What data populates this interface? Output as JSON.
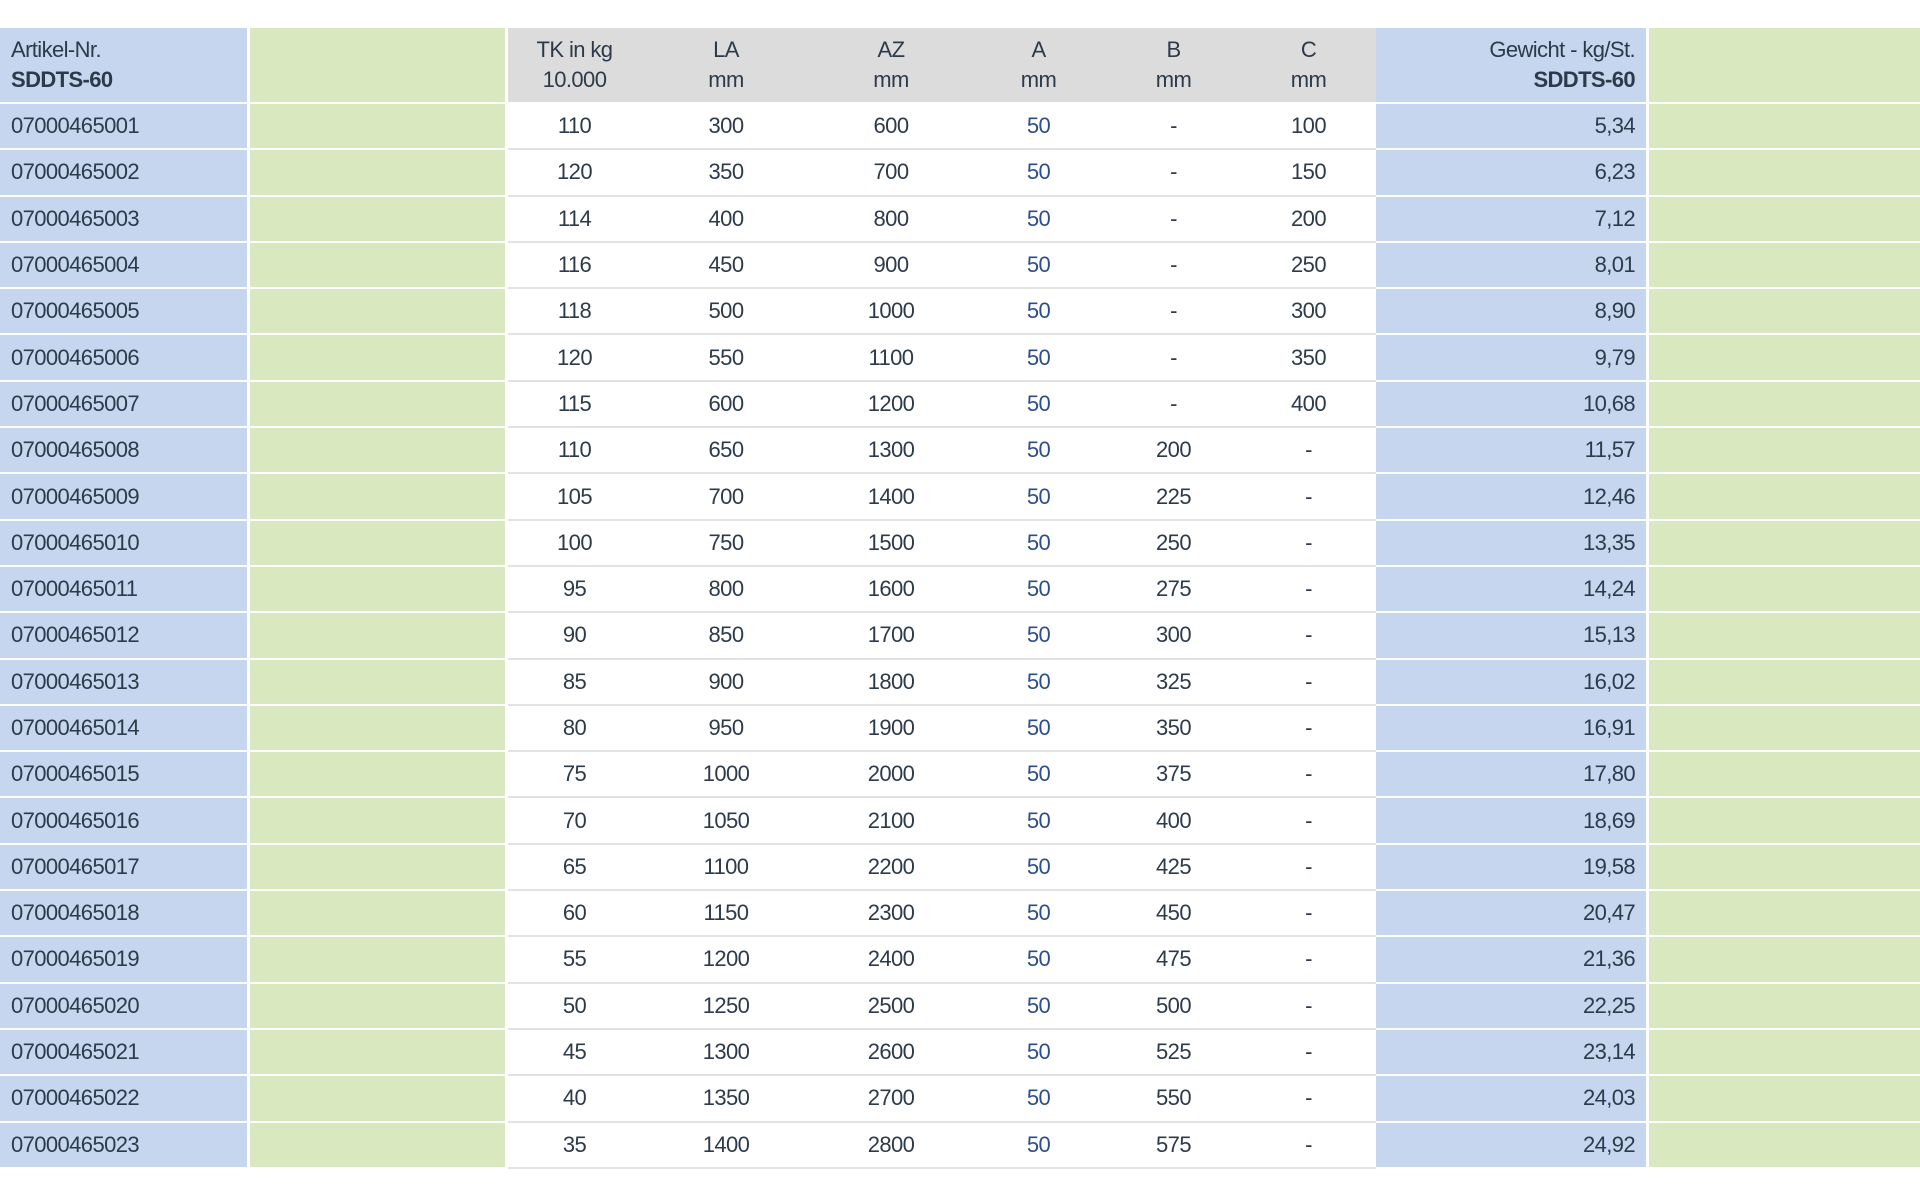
{
  "header": {
    "artikel_label": "Artikel-Nr.",
    "artikel_sub": "SDDTS-60",
    "tk_label": "TK in kg",
    "tk_sub": "10.000",
    "la_label": "LA",
    "la_sub": "mm",
    "az_label": "AZ",
    "az_sub": "mm",
    "a_label": "A",
    "a_sub": "mm",
    "b_label": "B",
    "b_sub": "mm",
    "c_label": "C",
    "c_sub": "mm",
    "gewicht_label": "Gewicht - kg/St.",
    "gewicht_sub": "SDDTS-60"
  },
  "rows": [
    {
      "art": "07000465001",
      "tk": "110",
      "la": "300",
      "az": "600",
      "a": "50",
      "b": "-",
      "c": "100",
      "gew": "5,34"
    },
    {
      "art": "07000465002",
      "tk": "120",
      "la": "350",
      "az": "700",
      "a": "50",
      "b": "-",
      "c": "150",
      "gew": "6,23"
    },
    {
      "art": "07000465003",
      "tk": "114",
      "la": "400",
      "az": "800",
      "a": "50",
      "b": "-",
      "c": "200",
      "gew": "7,12"
    },
    {
      "art": "07000465004",
      "tk": "116",
      "la": "450",
      "az": "900",
      "a": "50",
      "b": "-",
      "c": "250",
      "gew": "8,01"
    },
    {
      "art": "07000465005",
      "tk": "118",
      "la": "500",
      "az": "1000",
      "a": "50",
      "b": "-",
      "c": "300",
      "gew": "8,90"
    },
    {
      "art": "07000465006",
      "tk": "120",
      "la": "550",
      "az": "1100",
      "a": "50",
      "b": "-",
      "c": "350",
      "gew": "9,79"
    },
    {
      "art": "07000465007",
      "tk": "115",
      "la": "600",
      "az": "1200",
      "a": "50",
      "b": "-",
      "c": "400",
      "gew": "10,68"
    },
    {
      "art": "07000465008",
      "tk": "110",
      "la": "650",
      "az": "1300",
      "a": "50",
      "b": "200",
      "c": "-",
      "gew": "11,57"
    },
    {
      "art": "07000465009",
      "tk": "105",
      "la": "700",
      "az": "1400",
      "a": "50",
      "b": "225",
      "c": "-",
      "gew": "12,46"
    },
    {
      "art": "07000465010",
      "tk": "100",
      "la": "750",
      "az": "1500",
      "a": "50",
      "b": "250",
      "c": "-",
      "gew": "13,35"
    },
    {
      "art": "07000465011",
      "tk": "95",
      "la": "800",
      "az": "1600",
      "a": "50",
      "b": "275",
      "c": "-",
      "gew": "14,24"
    },
    {
      "art": "07000465012",
      "tk": "90",
      "la": "850",
      "az": "1700",
      "a": "50",
      "b": "300",
      "c": "-",
      "gew": "15,13"
    },
    {
      "art": "07000465013",
      "tk": "85",
      "la": "900",
      "az": "1800",
      "a": "50",
      "b": "325",
      "c": "-",
      "gew": "16,02"
    },
    {
      "art": "07000465014",
      "tk": "80",
      "la": "950",
      "az": "1900",
      "a": "50",
      "b": "350",
      "c": "-",
      "gew": "16,91"
    },
    {
      "art": "07000465015",
      "tk": "75",
      "la": "1000",
      "az": "2000",
      "a": "50",
      "b": "375",
      "c": "-",
      "gew": "17,80"
    },
    {
      "art": "07000465016",
      "tk": "70",
      "la": "1050",
      "az": "2100",
      "a": "50",
      "b": "400",
      "c": "-",
      "gew": "18,69"
    },
    {
      "art": "07000465017",
      "tk": "65",
      "la": "1100",
      "az": "2200",
      "a": "50",
      "b": "425",
      "c": "-",
      "gew": "19,58"
    },
    {
      "art": "07000465018",
      "tk": "60",
      "la": "1150",
      "az": "2300",
      "a": "50",
      "b": "450",
      "c": "-",
      "gew": "20,47"
    },
    {
      "art": "07000465019",
      "tk": "55",
      "la": "1200",
      "az": "2400",
      "a": "50",
      "b": "475",
      "c": "-",
      "gew": "21,36"
    },
    {
      "art": "07000465020",
      "tk": "50",
      "la": "1250",
      "az": "2500",
      "a": "50",
      "b": "500",
      "c": "-",
      "gew": "22,25"
    },
    {
      "art": "07000465021",
      "tk": "45",
      "la": "1300",
      "az": "2600",
      "a": "50",
      "b": "525",
      "c": "-",
      "gew": "23,14"
    },
    {
      "art": "07000465022",
      "tk": "40",
      "la": "1350",
      "az": "2700",
      "a": "50",
      "b": "550",
      "c": "-",
      "gew": "24,03"
    },
    {
      "art": "07000465023",
      "tk": "35",
      "la": "1400",
      "az": "2800",
      "a": "50",
      "b": "575",
      "c": "-",
      "gew": "24,92"
    }
  ]
}
